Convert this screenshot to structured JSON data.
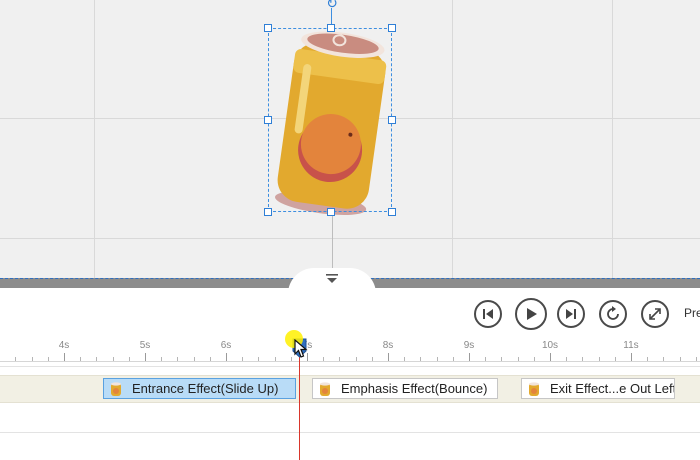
{
  "canvas": {
    "object_name": "orange-soda-can",
    "colors": {
      "background": "#f0f0f0",
      "selection": "#3d8ee0",
      "can_body": "#e2a92e",
      "fruit": "#e3843c"
    }
  },
  "controls": {
    "skip_back": "skip-back-icon",
    "play": "play-icon",
    "skip_forward": "skip-forward-icon",
    "replay": "replay-icon",
    "fullscreen": "fullscreen-icon",
    "preview_label": "Pre"
  },
  "timeline": {
    "ruler_labels": [
      "4s",
      "5s",
      "6s",
      "7s",
      "8s",
      "9s",
      "10s",
      "11s"
    ],
    "clips": [
      {
        "label": "Entrance Effect(Slide Up)",
        "selected": true
      },
      {
        "label": "Emphasis Effect(Bounce)",
        "selected": false
      },
      {
        "label": "Exit Effect...e Out Left)",
        "selected": false
      }
    ],
    "playhead_color": "#d9362b"
  }
}
